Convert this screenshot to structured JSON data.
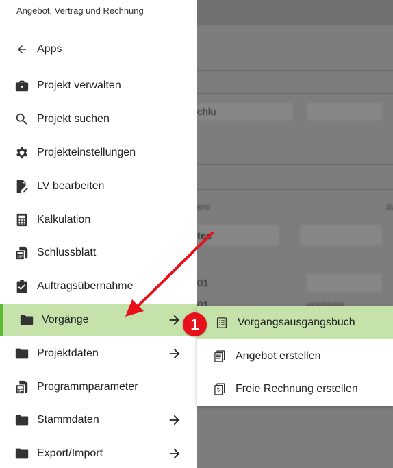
{
  "drawer": {
    "header": "Angebot, Vertrag und Rechnung",
    "back_label": "Apps",
    "items": [
      {
        "label": "Projekt verwalten"
      },
      {
        "label": "Projekt suchen"
      },
      {
        "label": "Projekteinstellungen"
      },
      {
        "label": "LV bearbeiten"
      },
      {
        "label": "Kalkulation"
      },
      {
        "label": "Schlussblatt"
      },
      {
        "label": "Auftragsübernahme"
      },
      {
        "label": "Vorgänge"
      },
      {
        "label": "Projektdaten"
      },
      {
        "label": "Programmparameter"
      },
      {
        "label": "Stammdaten"
      },
      {
        "label": "Export/Import"
      }
    ]
  },
  "submenu": {
    "items": [
      {
        "label": "Vorgangsausgangsbuch"
      },
      {
        "label": "Angebot erstellen"
      },
      {
        "label": "Freie Rechnung erstellen"
      }
    ]
  },
  "annotation": {
    "step_number": "1",
    "color": "#e8101a"
  },
  "background": {
    "fragments": [
      "chlu",
      "zu",
      "ers",
      "tec",
      "01",
      "01",
      "vorgang"
    ]
  },
  "colors": {
    "active_bg": "#c4e2aa",
    "active_border": "#5cb833"
  }
}
